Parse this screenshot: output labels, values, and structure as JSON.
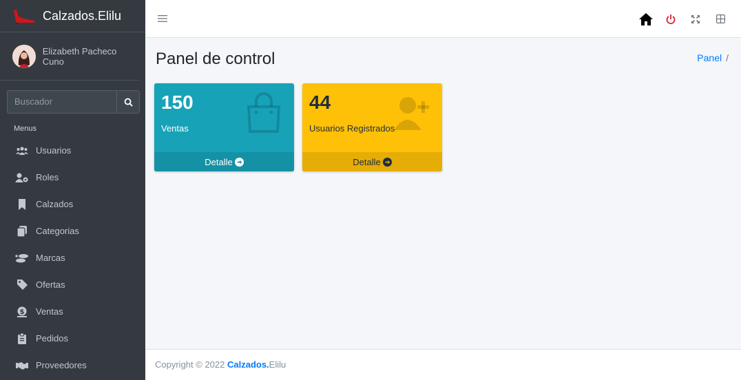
{
  "brand": {
    "name": "Calzados.Elilu"
  },
  "user": {
    "name": "Elizabeth Pacheco Cuno"
  },
  "search": {
    "placeholder": "Buscador"
  },
  "sidebar": {
    "header": "Menus",
    "items": [
      {
        "label": "Usuarios",
        "icon": "users-icon"
      },
      {
        "label": "Roles",
        "icon": "user-cog-icon"
      },
      {
        "label": "Calzados",
        "icon": "bookmark-icon"
      },
      {
        "label": "Categorias",
        "icon": "copy-icon"
      },
      {
        "label": "Marcas",
        "icon": "shoe-prints-icon"
      },
      {
        "label": "Ofertas",
        "icon": "tag-icon"
      },
      {
        "label": "Ventas",
        "icon": "money-icon"
      },
      {
        "label": "Pedidos",
        "icon": "clipboard-icon"
      },
      {
        "label": "Proveedores",
        "icon": "handshake-icon"
      }
    ]
  },
  "navbar": {
    "icons": [
      "home-icon",
      "power-icon",
      "expand-icon",
      "grid-icon"
    ],
    "power_color": "#dc3545"
  },
  "content": {
    "title": "Panel de control",
    "breadcrumb": {
      "item": "Panel",
      "separator": "/"
    }
  },
  "boxes": [
    {
      "value": "150",
      "label": "Ventas",
      "footer": "Detalle",
      "icon": "shopping-bag-icon",
      "color": "#17a2b8"
    },
    {
      "value": "44",
      "label": "Usuarios Registrados",
      "footer": "Detalle",
      "icon": "user-plus-icon",
      "color": "#ffc107"
    }
  ],
  "footer": {
    "prefix": "Copyright © 2022 ",
    "brand_strong": "Calzados.",
    "brand_rest": "Elilu"
  }
}
